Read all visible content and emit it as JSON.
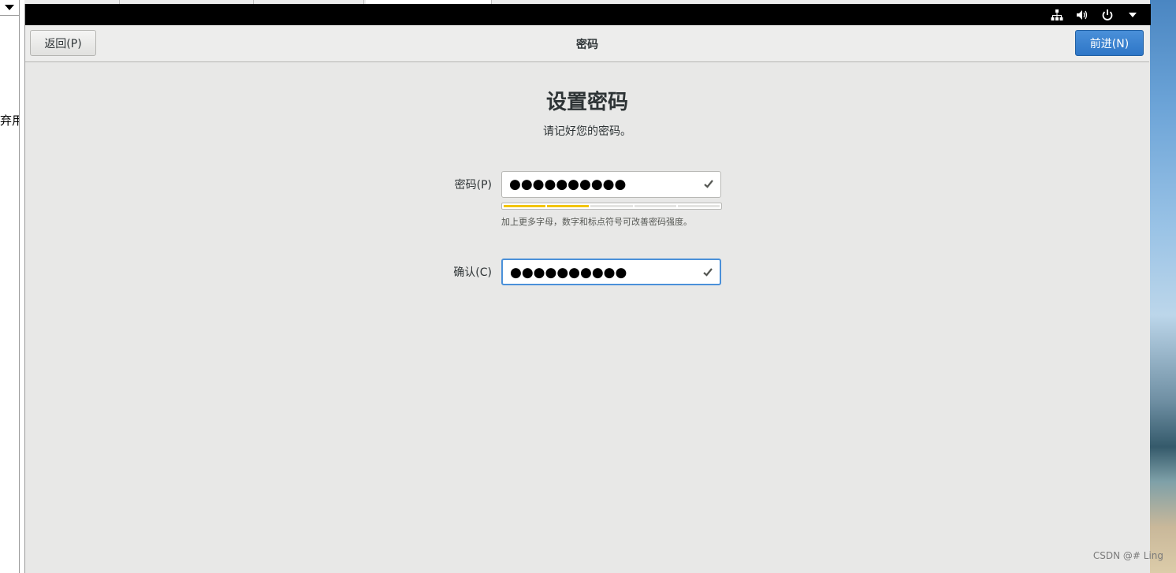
{
  "host": {
    "truncated_text": "弃用"
  },
  "header": {
    "back_label": "返回(P)",
    "title": "密码",
    "next_label": "前进(N)"
  },
  "page": {
    "title": "设置密码",
    "subtitle": "请记好您的密码。"
  },
  "form": {
    "password_label": "密码(P)",
    "password_value": "●●●●●●●●●●",
    "strength_level_segments": 2,
    "strength_total_segments": 5,
    "strength_hint": "加上更多字母，数字和标点符号可改善密码强度。",
    "confirm_label": "确认(C)",
    "confirm_value": "●●●●●●●●●●"
  },
  "system_tray": {
    "icons": [
      "network-icon",
      "volume-icon",
      "power-icon",
      "menu-arrow-icon"
    ]
  },
  "watermark": "CSDN @#  Ling",
  "colors": {
    "accent": "#4a90d9",
    "strength": "#f2c500",
    "background": "#e8e8e7"
  }
}
